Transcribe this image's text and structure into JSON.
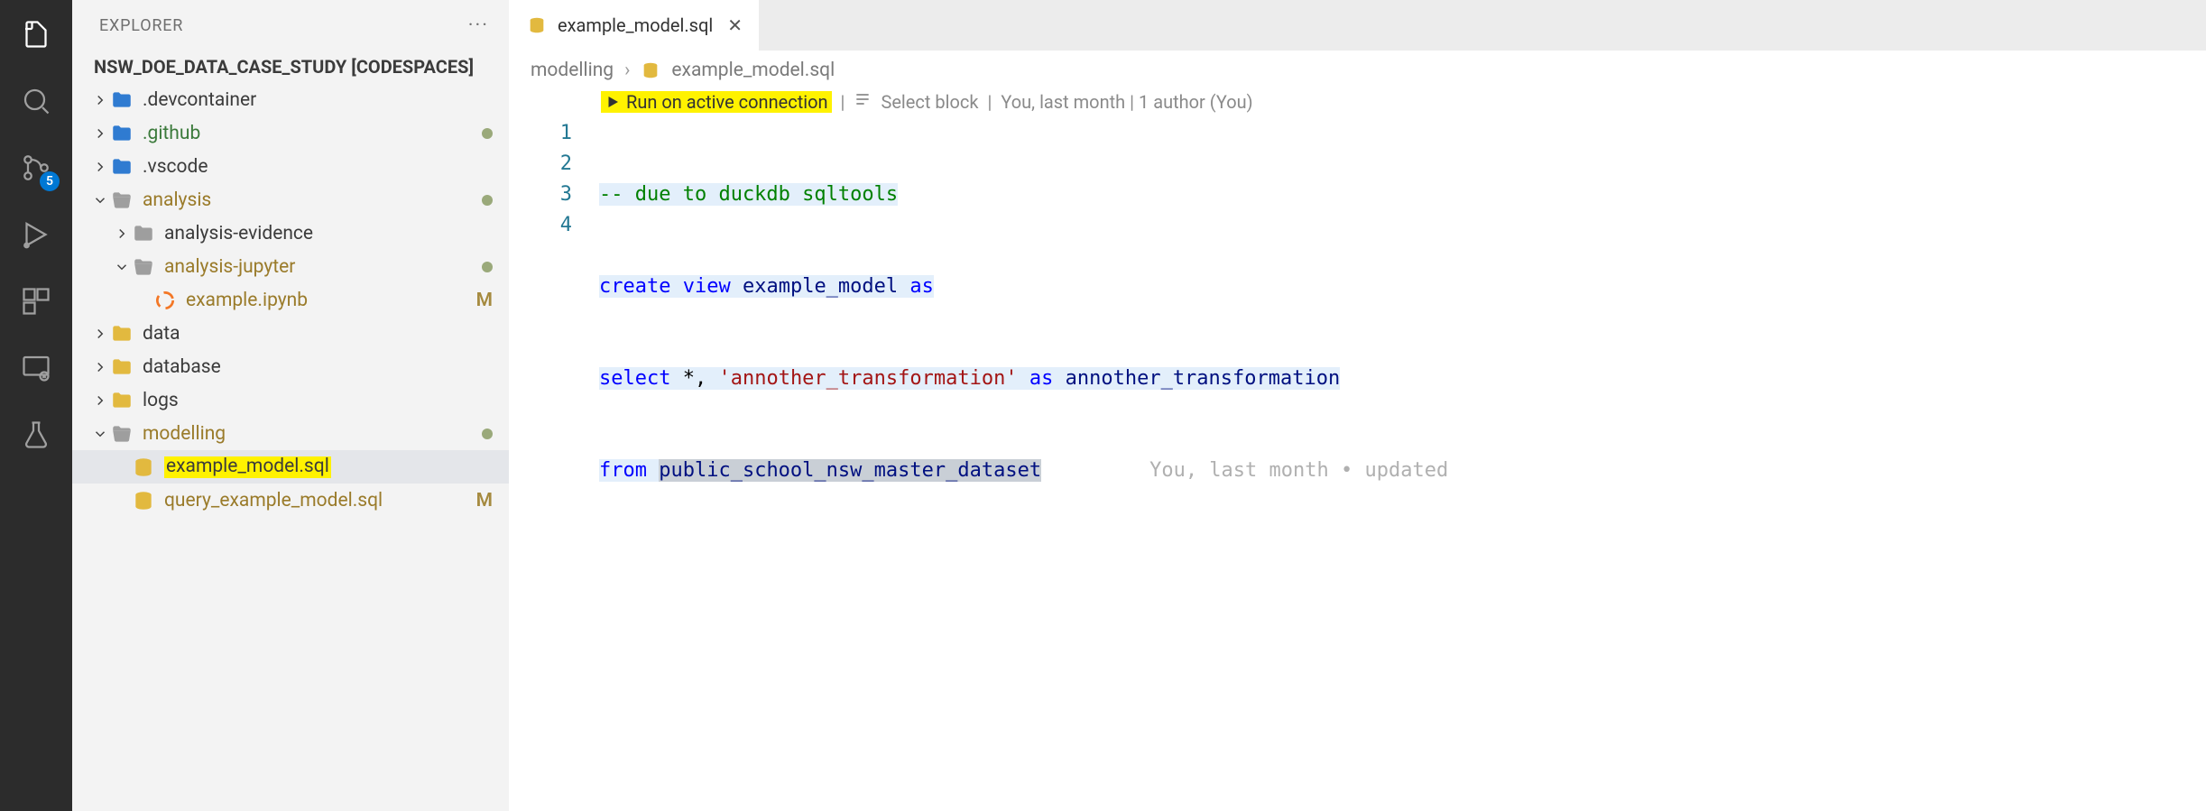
{
  "activity_bar": {
    "source_control_badge": "5"
  },
  "sidebar": {
    "title": "EXPLORER",
    "project_name": "NSW_DOE_DATA_CASE_STUDY [CODESPACES]",
    "items": [
      {
        "label": ".devcontainer"
      },
      {
        "label": ".github"
      },
      {
        "label": ".vscode"
      },
      {
        "label": "analysis"
      },
      {
        "label": "analysis-evidence"
      },
      {
        "label": "analysis-jupyter"
      },
      {
        "label": "example.ipynb",
        "status": "M"
      },
      {
        "label": "data"
      },
      {
        "label": "database"
      },
      {
        "label": "logs"
      },
      {
        "label": "modelling"
      },
      {
        "label": "example_model.sql"
      },
      {
        "label": "query_example_model.sql",
        "status": "M"
      }
    ]
  },
  "tab": {
    "label": "example_model.sql"
  },
  "breadcrumb": {
    "segments": [
      "modelling",
      "example_model.sql"
    ]
  },
  "codelens": {
    "run": "Run on active connection",
    "select_block": "Select block",
    "meta": "You, last month | 1 author (You)"
  },
  "code": {
    "l1": "-- due to duckdb sqltools",
    "l2_kw1": "create",
    "l2_kw2": "view",
    "l2_name": "example_model",
    "l2_kw3": "as",
    "l3_kw1": "select",
    "l3_star": " *, ",
    "l3_str": "'annother_transformation'",
    "l3_kw2": "as",
    "l3_alias": "annother_transformation",
    "l4_kw1": "from",
    "l4_table": "public_school_nsw_master_dataset",
    "blame": "You, last month • updated "
  }
}
